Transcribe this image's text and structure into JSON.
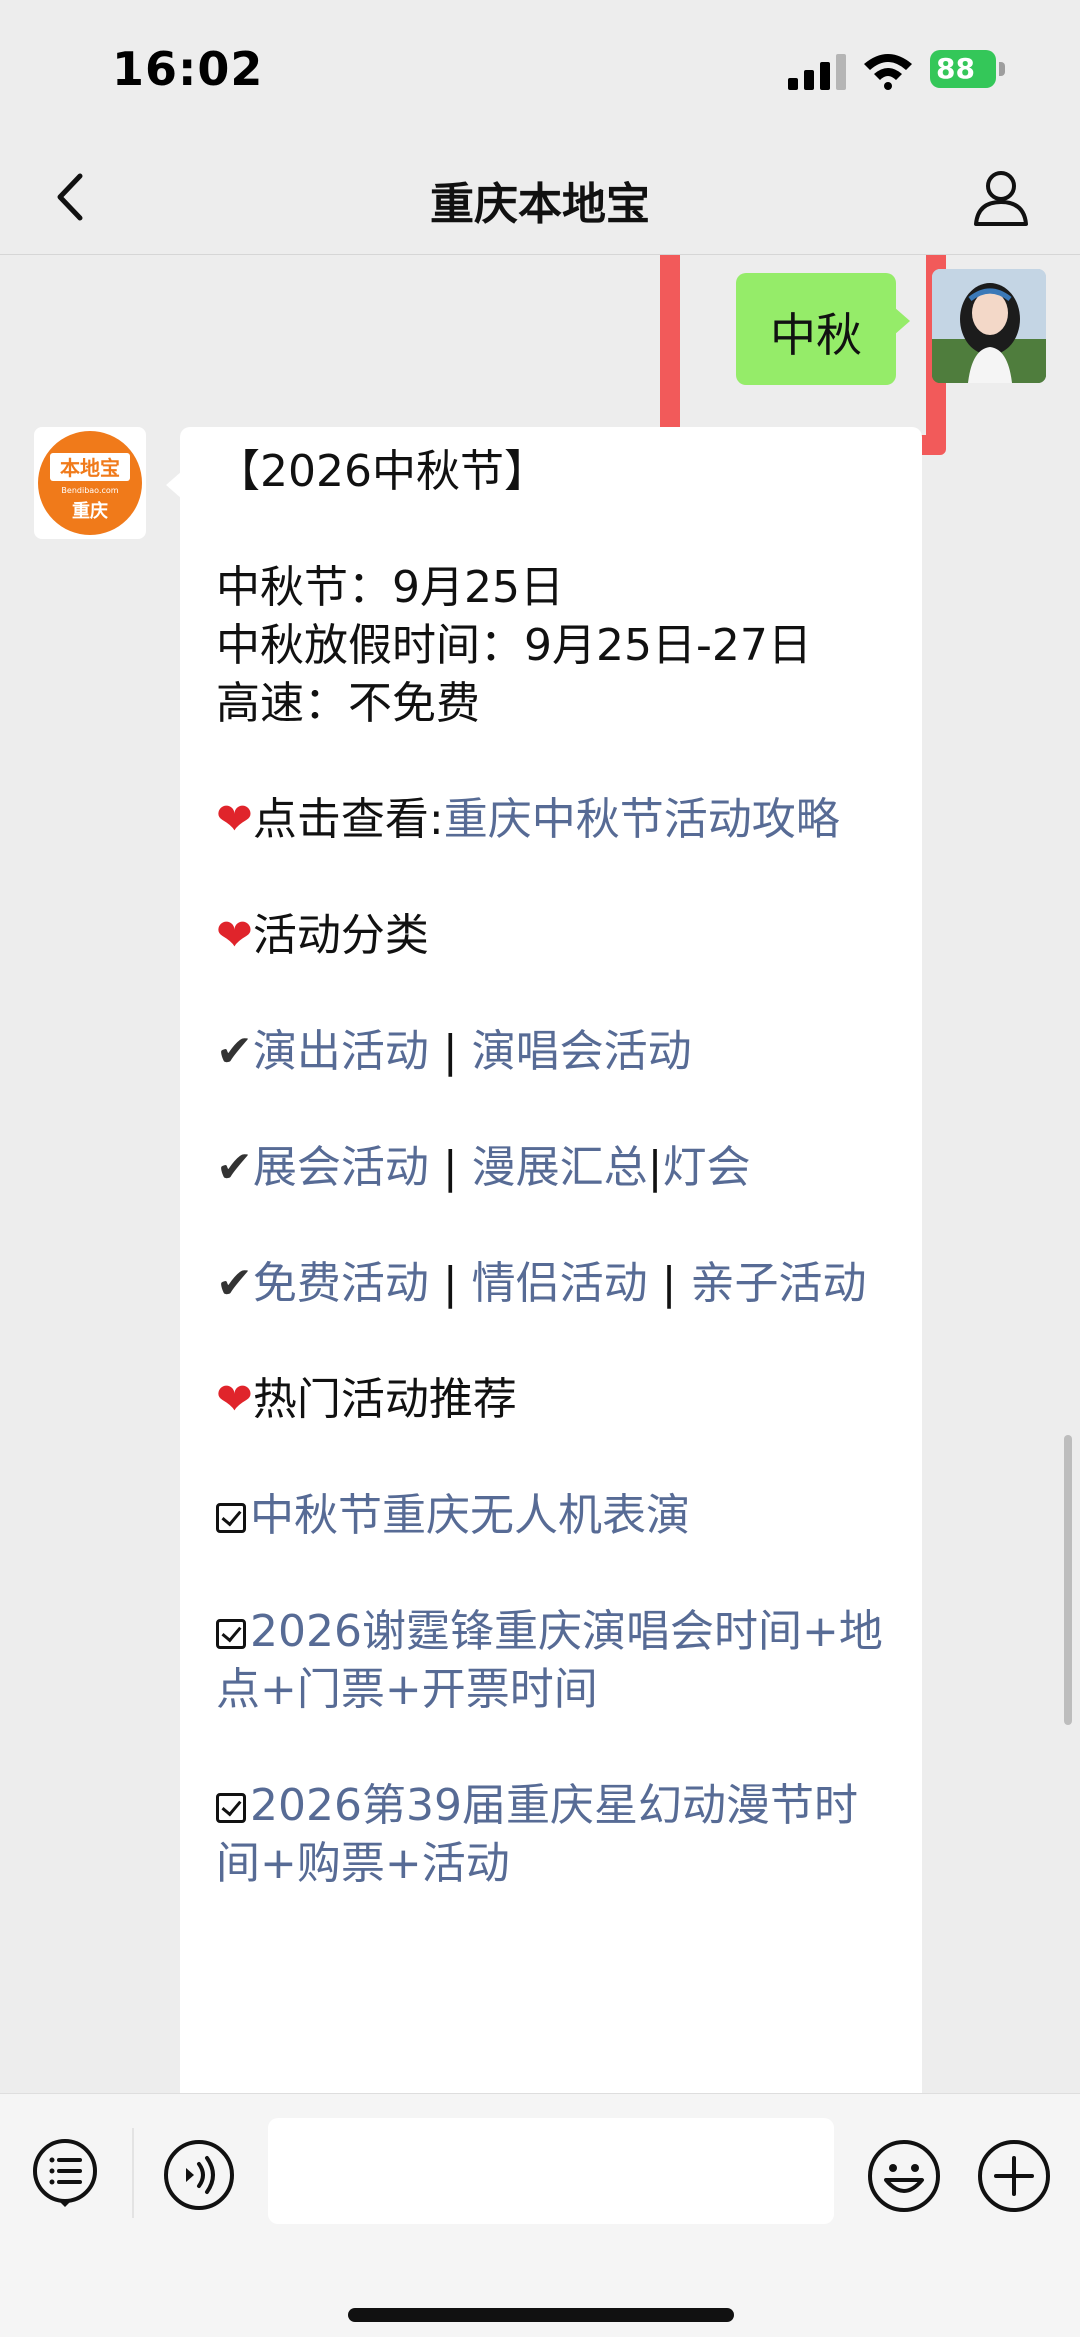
{
  "status_bar": {
    "time": "16:02",
    "battery": "88"
  },
  "nav": {
    "title": "重庆本地宝"
  },
  "chat": {
    "outgoing": {
      "text": "中秋"
    },
    "bot_avatar": {
      "top": "本地宝",
      "site": "Bendibao.com",
      "city": "重庆"
    },
    "incoming": {
      "title": "【2026中秋节】",
      "festival": "中秋节：9月25日",
      "holiday": "中秋放假时间：9月25日-27日",
      "highway": "高速：不免费",
      "guide_prefix": "点击查看:",
      "guide_link": "重庆中秋节活动攻略",
      "category_heading": "活动分类",
      "row1": {
        "a": "演出活动",
        "sep": " | ",
        "b": "演唱会活动"
      },
      "row2": {
        "a": "展会活动",
        "sep": " | ",
        "b": "漫展汇总",
        "sep2": "|",
        "c": "灯会"
      },
      "row3": {
        "a": "免费活动",
        "sep": " | ",
        "b": "情侣活动",
        "sep2": " | ",
        "c": "亲子活动"
      },
      "hot_heading": "热门活动推荐",
      "hot1": "中秋节重庆无人机表演",
      "hot2": "2026谢霆锋重庆演唱会时间+地点+门票+开票时间",
      "hot3": "2026第39届重庆星幻动漫节时间+购票+活动"
    }
  },
  "colors": {
    "link": "#576b95",
    "outgoing_bubble": "#95ec69",
    "highlight": "#f25a5a",
    "battery": "#34c759"
  }
}
